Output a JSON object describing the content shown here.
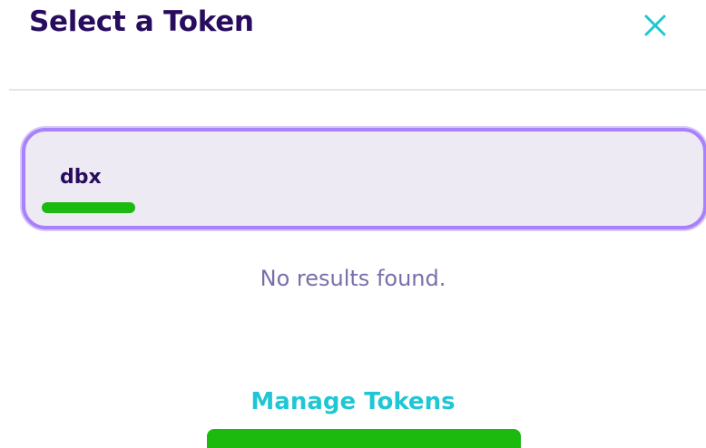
{
  "modal": {
    "title": "Select a Token",
    "close_icon": "close-icon"
  },
  "search": {
    "value": "dbx",
    "placeholder": ""
  },
  "results": {
    "empty_message": "No results found."
  },
  "footer": {
    "manage_label": "Manage Tokens"
  },
  "colors": {
    "title": "#280d5f",
    "accent": "#1fc7d4",
    "input_border": "#a881fc",
    "input_background": "#eeeaf4",
    "secondary_text": "#7a6eaa",
    "highlight": "#1cb90f"
  }
}
